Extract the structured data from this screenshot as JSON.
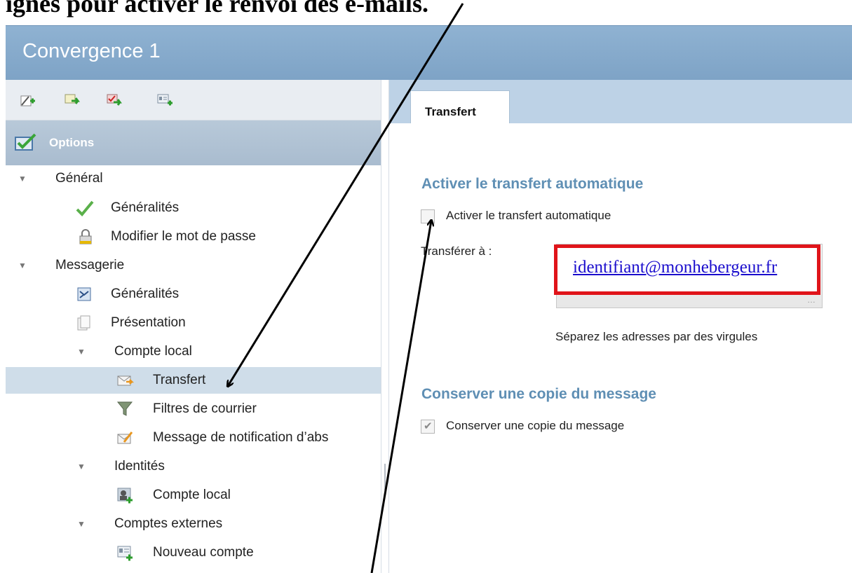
{
  "caption_fragment": "ignes pour activer le renvoi  des e-mails.",
  "window": {
    "title": "Convergence 1"
  },
  "toolbar": {
    "buttons": [
      {
        "name": "compose-icon"
      },
      {
        "name": "move-to-icon"
      },
      {
        "name": "move-checked-icon"
      },
      {
        "name": "address-card-icon"
      }
    ]
  },
  "options": {
    "label": "Options"
  },
  "tree": {
    "general": "Général",
    "general_overview": "Généralités",
    "change_password": "Modifier le mot de passe",
    "messaging": "Messagerie",
    "messaging_overview": "Généralités",
    "presentation": "Présentation",
    "local_account": "Compte local",
    "transfer": "Transfert",
    "mail_filters": "Filtres de courrier",
    "absence_notice": "Message de notification d’abs",
    "identities": "Identités",
    "identities_local_account": "Compte local",
    "external_accounts": "Comptes externes",
    "new_account": "Nouveau compte"
  },
  "tabs": {
    "active": "Transfert"
  },
  "auto_forward": {
    "section_title": "Activer le transfert automatique",
    "checkbox_label": "Activer le transfert automatique",
    "checked": false,
    "forward_to_label": "Transférer à :",
    "hint": "Séparez les adresses par des virgules",
    "email": "identifiant@monhebergeur.fr"
  },
  "keep_copy": {
    "section_title": "Conserver une copie du message",
    "checkbox_label": "Conserver une copie du message",
    "checked": true
  },
  "colors": {
    "titlebar": "#8fb2d2",
    "section_title": "#5f8fb4",
    "highlight": "#e0141a",
    "link": "#1a0dcd",
    "selected_row": "#cfdde9"
  }
}
